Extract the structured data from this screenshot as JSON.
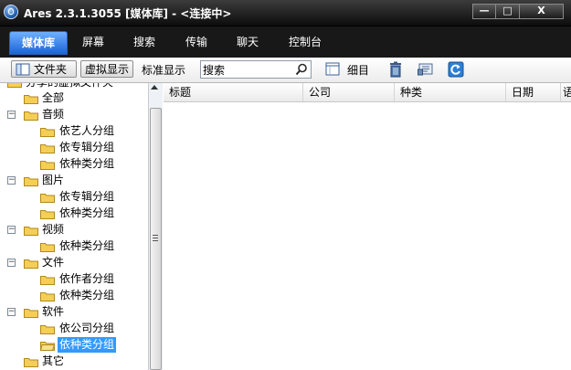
{
  "window": {
    "title": "Ares 2.3.1.3055  [媒体库] - <连接中>",
    "controls": {
      "minimize": "—",
      "maximize": "□",
      "close": "X"
    }
  },
  "nav": {
    "tabs": [
      {
        "label": "媒体库",
        "active": true
      },
      {
        "label": "屏幕"
      },
      {
        "label": "搜索"
      },
      {
        "label": "传输"
      },
      {
        "label": "聊天"
      },
      {
        "label": "控制台"
      }
    ]
  },
  "toolbar": {
    "folders_label": "文件夹",
    "virtual_label": "虚拟显示",
    "standard_label": "标准显示",
    "search_value": "搜索",
    "details_label": "细目"
  },
  "tree": {
    "partial_top": "分享的虚拟文件夹",
    "all": "全部",
    "audio": "音频",
    "audio_by_artist": "依艺人分组",
    "audio_by_album": "依专辑分组",
    "audio_by_genre": "依种类分组",
    "images": "图片",
    "images_by_album": "依专辑分组",
    "images_by_genre": "依种类分组",
    "video": "视频",
    "video_by_genre": "依种类分组",
    "documents": "文件",
    "docs_by_author": "依作者分组",
    "docs_by_genre": "依种类分组",
    "software": "软件",
    "software_by_company": "依公司分组",
    "software_by_genre": "依种类分组",
    "other": "其它",
    "expander_minus": "−"
  },
  "list": {
    "columns": {
      "title": "标题",
      "company": "公司",
      "genre": "种类",
      "date": "日期",
      "partial": "语"
    }
  },
  "colors": {
    "nav_bg": "#181818",
    "tab_active": "#1a64d6",
    "selection": "#3399ff",
    "folder": "#f5cf55"
  }
}
